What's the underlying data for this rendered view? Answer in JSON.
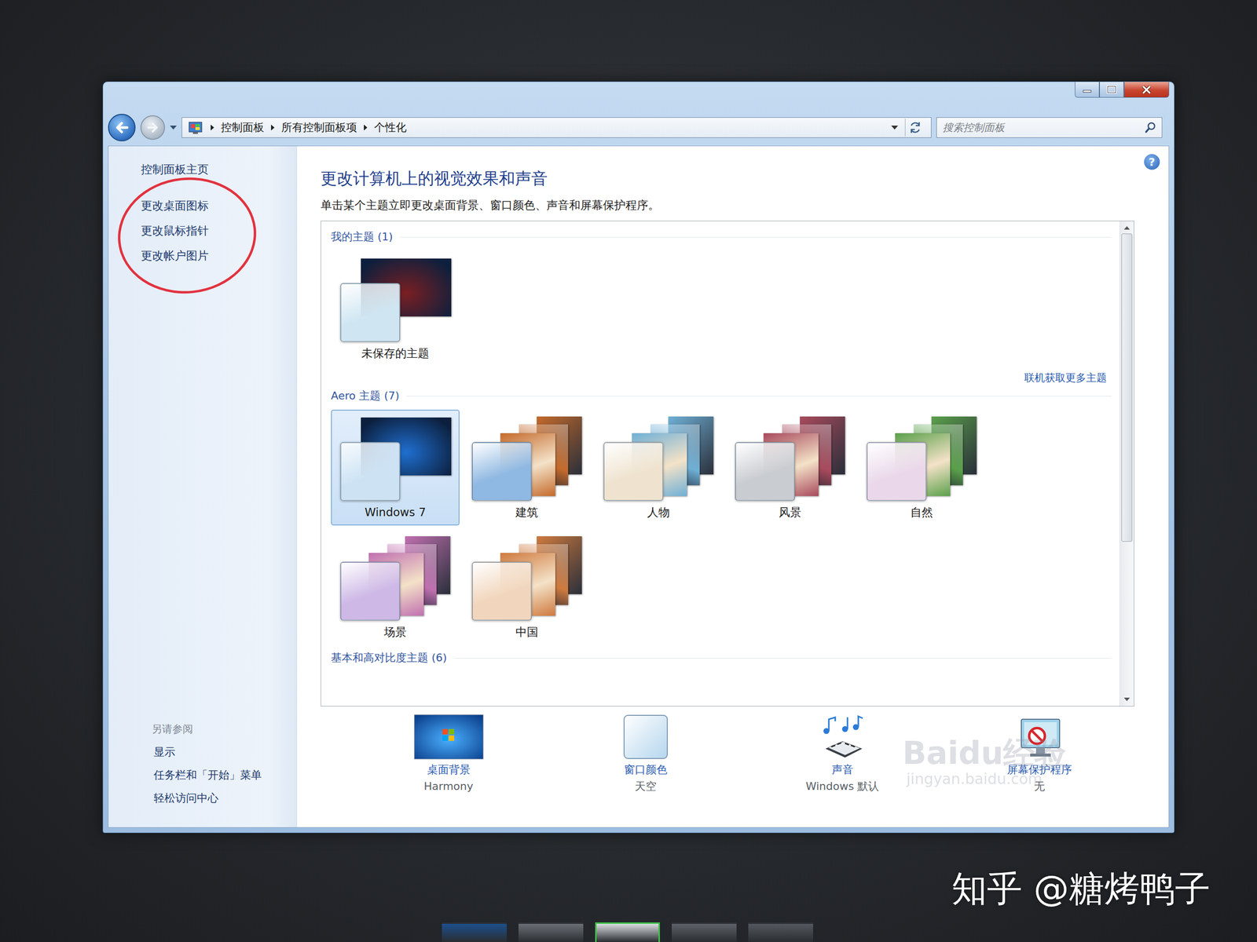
{
  "window": {
    "controls": [
      "minimize",
      "maximize",
      "close"
    ]
  },
  "address_bar": {
    "crumbs": [
      "控制面板",
      "所有控制面板项",
      "个性化"
    ]
  },
  "search": {
    "placeholder": "搜索控制面板"
  },
  "sidebar": {
    "home": "控制面板主页",
    "links": [
      "更改桌面图标",
      "更改鼠标指针",
      "更改帐户图片"
    ],
    "see_also_title": "另请参阅",
    "see_also": [
      "显示",
      "任务栏和「开始」菜单",
      "轻松访问中心"
    ]
  },
  "main": {
    "help": "?",
    "heading": "更改计算机上的视觉效果和声音",
    "subtitle": "单击某个主题立即更改桌面背景、窗口颜色、声音和屏幕保护程序。"
  },
  "theme_list": {
    "online_link": "联机获取更多主题",
    "groups": [
      {
        "title": "我的主题 (1)",
        "themes": [
          {
            "label": "未保存的主题",
            "selected": false,
            "kind": "single",
            "color": "#7a1f22",
            "glass": "#cfe6f2"
          }
        ]
      },
      {
        "title": "Aero 主题 (7)",
        "themes": [
          {
            "label": "Windows 7",
            "selected": true,
            "kind": "single",
            "color": "#1f6fd0",
            "glass": "#cde3f4"
          },
          {
            "label": "建筑",
            "selected": false,
            "kind": "stack",
            "color": "#c46a2b",
            "glass": "#8fb8e2"
          },
          {
            "label": "人物",
            "selected": false,
            "kind": "stack",
            "color": "#6fb0d6",
            "glass": "#efe3cf"
          },
          {
            "label": "风景",
            "selected": false,
            "kind": "stack",
            "color": "#a84a5c",
            "glass": "#c9ccd1"
          },
          {
            "label": "自然",
            "selected": false,
            "kind": "stack",
            "color": "#5aa04a",
            "glass": "#ead8ea"
          },
          {
            "label": "场景",
            "selected": false,
            "kind": "stack",
            "color": "#c070b0",
            "glass": "#cdb8e6"
          },
          {
            "label": "中国",
            "selected": false,
            "kind": "stack",
            "color": "#cf7a3e",
            "glass": "#f1d6bd"
          }
        ]
      },
      {
        "title": "基本和高对比度主题 (6)",
        "themes": []
      }
    ]
  },
  "scrollbar": {
    "level": 0.67
  },
  "settings": [
    {
      "label": "桌面背景",
      "value": "Harmony",
      "kind": "wallpaper"
    },
    {
      "label": "窗口颜色",
      "value": "天空",
      "kind": "color"
    },
    {
      "label": "声音",
      "value": "Windows 默认",
      "kind": "sound"
    },
    {
      "label": "屏幕保护程序",
      "value": "无",
      "kind": "screensaver"
    }
  ],
  "watermarks": {
    "baidu": "Baidu经验",
    "baidu_url": "jingyan.baidu.com",
    "zhihu": "知乎 @糖烤鸭子"
  },
  "taskbar": [
    {
      "selected": false,
      "color": "#1c4f8c"
    },
    {
      "selected": false,
      "color": "#6b6f75"
    },
    {
      "selected": true,
      "color": "#d9dde2"
    },
    {
      "selected": false,
      "color": "#5e6268"
    },
    {
      "selected": false,
      "color": "#54585e"
    }
  ]
}
